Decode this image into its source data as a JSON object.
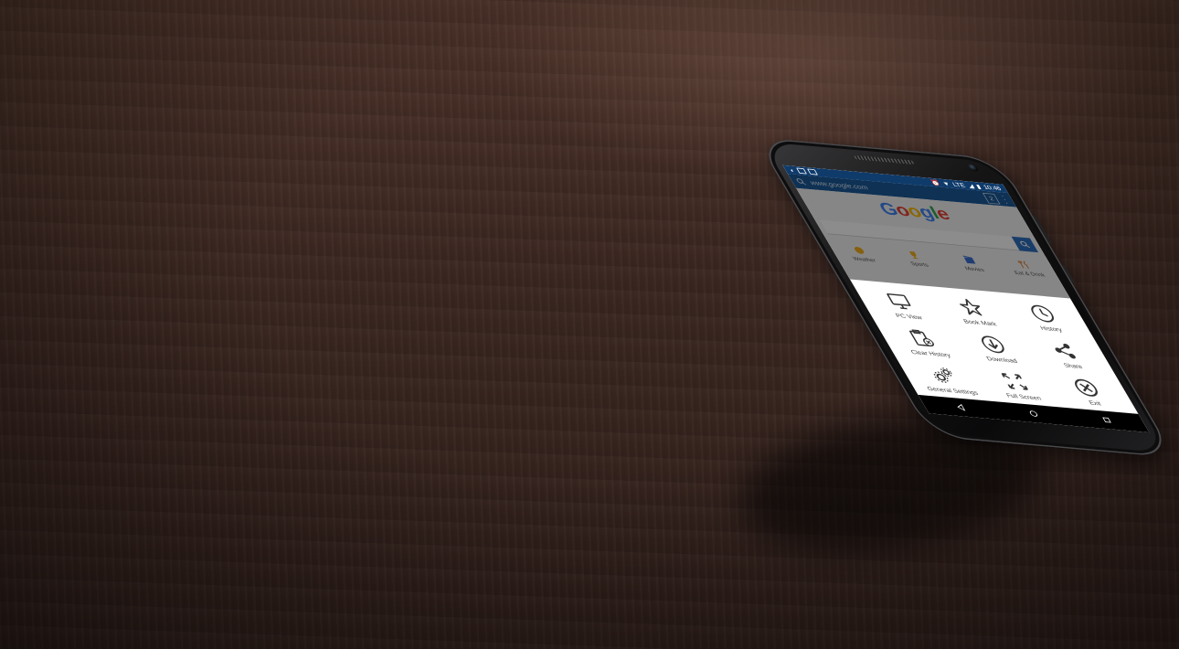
{
  "status_bar": {
    "time": "10:46",
    "network": "LTE"
  },
  "browser": {
    "url": "www.google.com",
    "tab_count": "2"
  },
  "page": {
    "logo_letters": [
      "G",
      "o",
      "o",
      "g",
      "l",
      "e"
    ],
    "logo_colors": [
      "#4285f4",
      "#ea4335",
      "#fbbc05",
      "#4285f4",
      "#34a853",
      "#ea4335"
    ],
    "quick_links": [
      {
        "label": "Weather",
        "icon": "weather-icon",
        "color": "#f2b01e"
      },
      {
        "label": "Sports",
        "icon": "trophy-icon",
        "color": "#f2b01e"
      },
      {
        "label": "Movies",
        "icon": "movie-icon",
        "color": "#3b6fd1"
      },
      {
        "label": "Eat & Drink",
        "icon": "fork-knife-icon",
        "color": "#e07b2d"
      }
    ]
  },
  "menu": {
    "items": [
      {
        "label": "PC View",
        "icon": "monitor-icon"
      },
      {
        "label": "Book Mark",
        "icon": "star-icon"
      },
      {
        "label": "History",
        "icon": "clock-icon"
      },
      {
        "label": "Clear History",
        "icon": "clipboard-clear-icon"
      },
      {
        "label": "Download",
        "icon": "download-icon"
      },
      {
        "label": "Share",
        "icon": "share-icon"
      },
      {
        "label": "General Settings",
        "icon": "gears-icon"
      },
      {
        "label": "Full Screen",
        "icon": "fullscreen-icon"
      },
      {
        "label": "Exit",
        "icon": "exit-icon"
      }
    ]
  },
  "colors": {
    "status_bar": "#0f3b6b",
    "address_bar": "#1a5a9a",
    "accent": "#2f6fbf",
    "menu_icon": "#333333"
  }
}
